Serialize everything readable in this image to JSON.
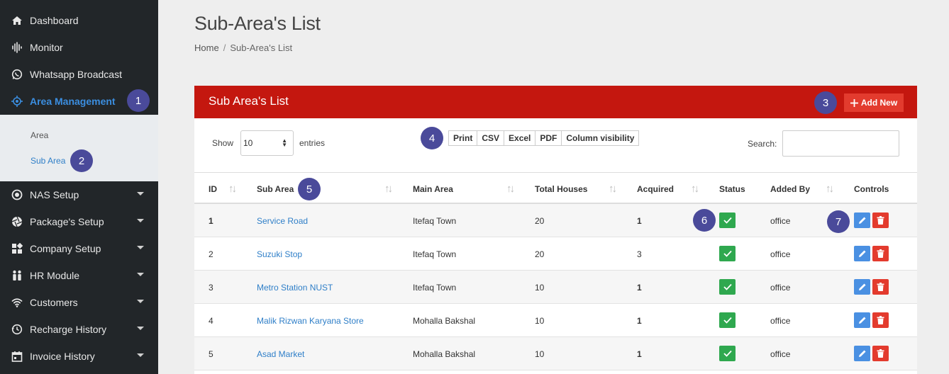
{
  "sidebar": {
    "items": [
      {
        "label": "Dashboard",
        "icon": "home-icon"
      },
      {
        "label": "Monitor",
        "icon": "waveform-icon"
      },
      {
        "label": "Whatsapp Broadcast",
        "icon": "whatsapp-icon"
      },
      {
        "label": "Area Management",
        "icon": "target-icon"
      },
      {
        "label": "NAS Setup",
        "icon": "circle-dot-icon"
      },
      {
        "label": "Package's Setup",
        "icon": "aperture-icon"
      },
      {
        "label": "Company Setup",
        "icon": "grid-icon"
      },
      {
        "label": "HR Module",
        "icon": "people-icon"
      },
      {
        "label": "Customers",
        "icon": "wifi-icon"
      },
      {
        "label": "Recharge History",
        "icon": "recharge-icon"
      },
      {
        "label": "Invoice History",
        "icon": "calendar-icon"
      }
    ],
    "submenu": [
      {
        "label": "Area"
      },
      {
        "label": "Sub Area"
      }
    ],
    "active_color": "#3b8ee0"
  },
  "header": {
    "title": "Sub-Area's List",
    "breadcrumb": {
      "home": "Home",
      "sep": "/",
      "current": "Sub-Area's List"
    }
  },
  "card": {
    "title": "Sub Area's List",
    "add_label": "Add New",
    "show_label": "Show",
    "page_length": "10",
    "entries_label": "entries",
    "export_buttons": [
      "Print",
      "CSV",
      "Excel",
      "PDF",
      "Column visibility"
    ],
    "search_label": "Search:",
    "header_color": "#c4170f"
  },
  "table": {
    "columns": [
      "ID",
      "Sub Area",
      "Main Area",
      "Total Houses",
      "Acquired",
      "Status",
      "Added By",
      "Controls"
    ],
    "rows": [
      {
        "id": "1",
        "sub_area": "Service Road",
        "main_area": "Itefaq Town",
        "total_houses": "20",
        "acquired": "1",
        "added_by": "office"
      },
      {
        "id": "2",
        "sub_area": "Suzuki Stop",
        "main_area": "Itefaq Town",
        "total_houses": "20",
        "acquired": "3",
        "added_by": "office"
      },
      {
        "id": "3",
        "sub_area": "Metro Station NUST",
        "main_area": "Itefaq Town",
        "total_houses": "10",
        "acquired": "1",
        "added_by": "office"
      },
      {
        "id": "4",
        "sub_area": "Malik Rizwan Karyana Store",
        "main_area": "Mohalla Bakshal",
        "total_houses": "10",
        "acquired": "1",
        "added_by": "office"
      },
      {
        "id": "5",
        "sub_area": "Asad Market",
        "main_area": "Mohalla Bakshal",
        "total_houses": "10",
        "acquired": "1",
        "added_by": "office"
      }
    ]
  },
  "badges": [
    "1",
    "2",
    "3",
    "4",
    "5",
    "6",
    "7"
  ]
}
